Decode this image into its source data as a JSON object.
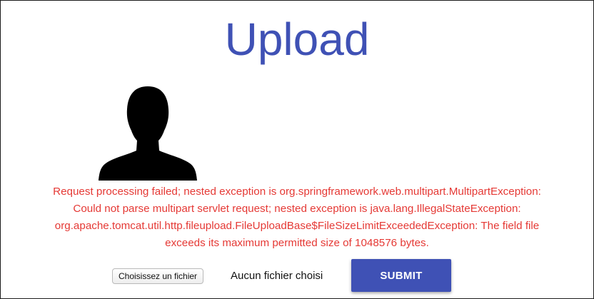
{
  "page": {
    "title": "Upload"
  },
  "avatar": {
    "icon": "user-silhouette-icon",
    "color": "#000000"
  },
  "error": {
    "lines": [
      "Request processing failed; nested exception is org.springframework.web.multipart.MultipartException:",
      "Could not parse multipart servlet request; nested exception is java.lang.IllegalStateException:",
      "org.apache.tomcat.util.http.fileupload.FileUploadBase$FileSizeLimitExceededException: The field file",
      "exceeds its maximum permitted size of 1048576 bytes."
    ],
    "color": "#e53935"
  },
  "upload": {
    "choose_file_label": "Choisissez un fichier",
    "file_status": "Aucun fichier choisi",
    "submit_label": "SUBMIT"
  },
  "colors": {
    "accent": "#3f51b5",
    "error": "#e53935"
  }
}
